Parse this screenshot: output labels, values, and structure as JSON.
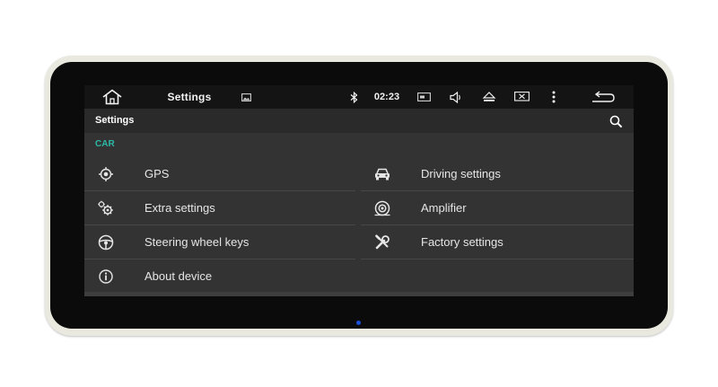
{
  "status_bar": {
    "title": "Settings",
    "time": "02:23",
    "icons": [
      "home-icon",
      "image-icon",
      "bluetooth-icon",
      "radio-icon",
      "volume-icon",
      "eject-icon",
      "screen-icon",
      "more-vert-icon",
      "back-icon"
    ]
  },
  "action_bar": {
    "title": "Settings",
    "search_icon": "search-icon"
  },
  "category": {
    "label": "CAR"
  },
  "items": [
    {
      "label": "GPS",
      "icon": "gps-icon"
    },
    {
      "label": "Driving settings",
      "icon": "car-icon"
    },
    {
      "label": "Extra settings",
      "icon": "gears-icon"
    },
    {
      "label": "Amplifier",
      "icon": "speaker-icon"
    },
    {
      "label": "Steering wheel keys",
      "icon": "steering-wheel-icon"
    },
    {
      "label": "Factory settings",
      "icon": "wrench-icon"
    },
    {
      "label": "About device",
      "icon": "info-icon"
    }
  ],
  "colors": {
    "accent": "#2db9a6",
    "background": "#333333",
    "status_bar": "#141414",
    "action_bar": "#2a2a2a"
  }
}
